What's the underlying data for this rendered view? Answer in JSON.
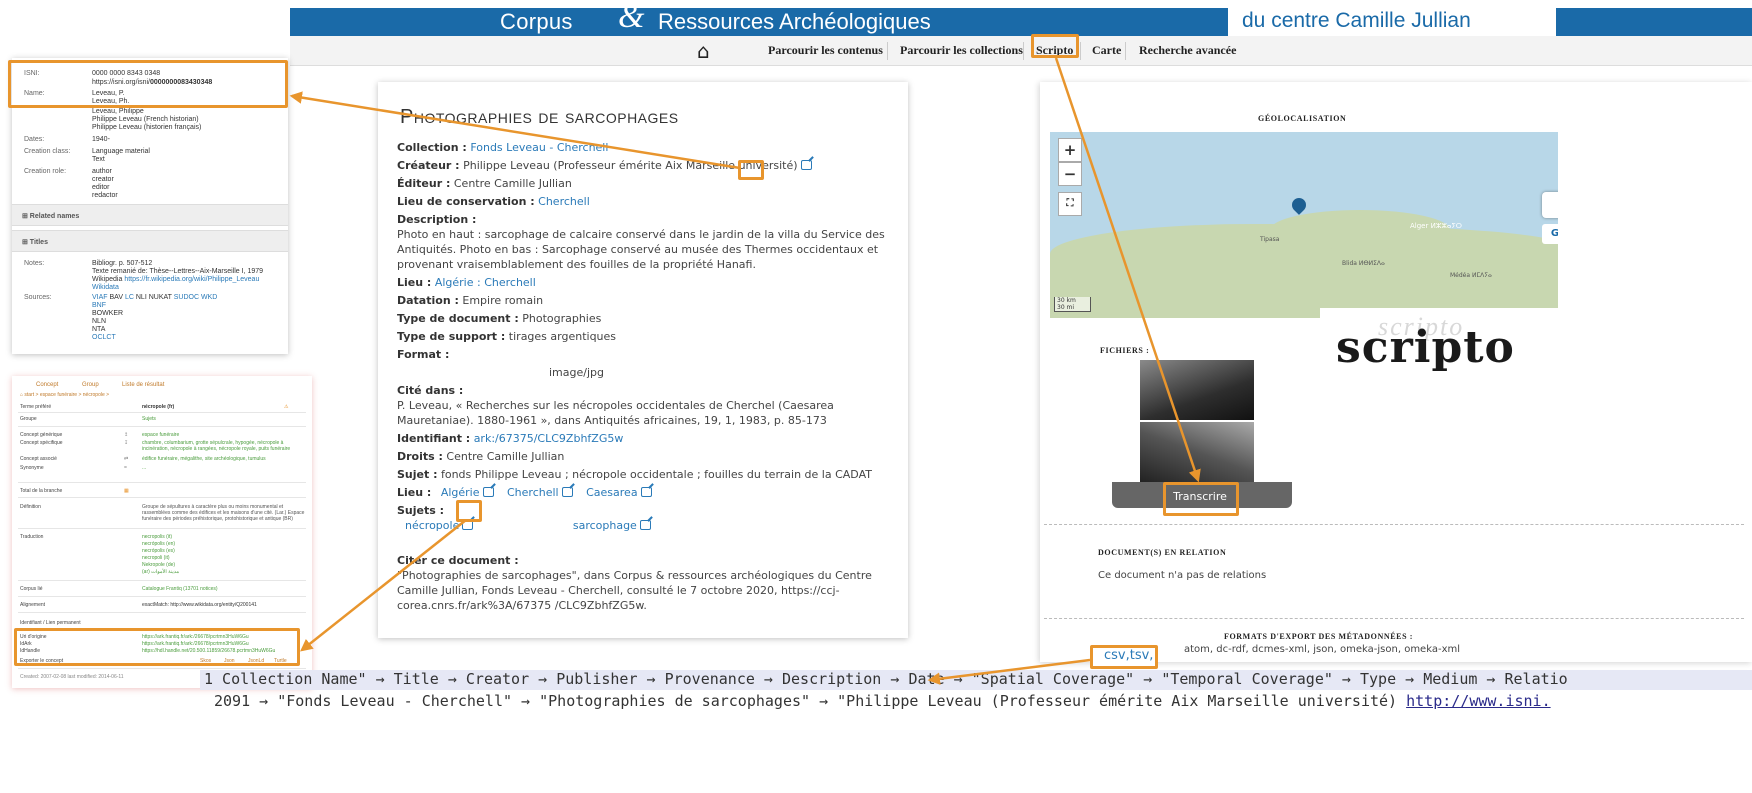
{
  "header": {
    "brand_left": "Corpus",
    "brand_amp": "&",
    "brand_right": "Ressources Archéologiques",
    "brand_center": "du centre Camille Jullian",
    "nav": [
      "Parcourir les contenus",
      "Parcourir les collections",
      "Scripto",
      "Carte",
      "Recherche avancée"
    ]
  },
  "record": {
    "title": "Photographies de sarcophages",
    "fields": {
      "collection_label": "Collection :",
      "collection_value": "Fonds Leveau - Cherchell",
      "createur_label": "Créateur :",
      "createur_value": "Philippe Leveau (Professeur émérite Aix Marseille université)",
      "editeur_label": "Éditeur :",
      "editeur_value": "Centre Camille Jullian",
      "lieu_cons_label": "Lieu de conservation :",
      "lieu_cons_value": "Cherchell",
      "description_label": "Description :",
      "description_value": "Photo en haut : sarcophage de calcaire conservé dans le jardin de la villa du Service des Antiquités. Photo en bas : Sarcophage conservé au musée des Thermes occidentaux et provenant vraisemblablement des fouilles de la propriété Hanafi.",
      "lieu_label": "Lieu :",
      "lieu_value": "Algérie : Cherchell",
      "datation_label": "Datation :",
      "datation_value": "Empire romain",
      "typedoc_label": "Type de document :",
      "typedoc_value": "Photographies",
      "typesupport_label": "Type de support :",
      "typesupport_value": "tirages argentiques",
      "format_label": "Format :",
      "format_value": "image/jpg",
      "cite_label": "Cité dans :",
      "cite_value": "P. Leveau, « Recherches sur les nécropoles occidentales de Cherchel (Caesarea Mauretaniae). 1880-1961 », dans Antiquités africaines, 19, 1, 1983, p. 85-173",
      "identifiant_label": "Identifiant :",
      "identifiant_value": "ark:/67375/CLC9ZbhfZG5w",
      "droits_label": "Droits :",
      "droits_value": "Centre Camille Jullian",
      "sujet_label": "Sujet :",
      "sujet_value": "fonds Philippe Leveau ; nécropole occidentale ; fouilles du terrain de la CADAT",
      "lieu2_label": "Lieu :",
      "lieu2_values": [
        "Algérie",
        "Cherchell",
        "Caesarea"
      ],
      "sujets_label": "Sujets :",
      "sujets_values": [
        "nécropole",
        "sarcophage"
      ],
      "citer_label": "Citer ce document :",
      "citer_value": "\"Photographies de sarcophages\", dans Corpus & ressources archéologiques du Centre Camille Jullian, Fonds Leveau - Cherchell, consulté le 7 octobre 2020, https://ccj-corea.cnrs.fr/ark%3A/67375 /CLC9ZbhfZG5w."
    }
  },
  "right_panel": {
    "geo_heading": "Géolocalisation",
    "map": {
      "zoom_in": "+",
      "zoom_out": "−",
      "places": [
        "Alger ⵍⵣⵣⴰⵢⵔ",
        "Blida ⵍⴱⵍⵉⴷⴰ",
        "Médéa ⵍⵎⴷⵢⴰ",
        "Tipasa"
      ],
      "scale": [
        "30 km",
        "30 mi"
      ],
      "google_label": "G"
    },
    "files_heading": "Fichiers :",
    "transcribe_label": "Transcrire",
    "related_heading": "Document(s) en relation",
    "related_text": "Ce document n'a pas de relations",
    "export_heading": "Formats d'export des métadonnées :",
    "export_formats": "atom, dc-rdf, dcmes-xml, json, omeka-json, omeka-xml",
    "csv_label": "csv,tsv,"
  },
  "scripto_logo": {
    "ghost": "scripto",
    "main": "scripto"
  },
  "isni_panel": {
    "isni_label": "ISNI:",
    "isni_value": "0000 0000 8343 0348",
    "isni_url_prefix": "https://isni.org/isni/",
    "isni_url_bold": "0000000083430348",
    "name_label": "Name:",
    "names": [
      "Leveau, P.",
      "Leveau, Ph.",
      "Leveau, Philippe",
      "Philippe Leveau (French historian)",
      "Philippe Leveau (historien français)"
    ],
    "dates_label": "Dates:",
    "dates_value": "1940-",
    "class_label": "Creation class:",
    "class_values": [
      "Language material",
      "Text"
    ],
    "role_label": "Creation role:",
    "role_values": [
      "author",
      "creator",
      "editor",
      "redactor"
    ],
    "related_band": "⊞ Related names",
    "titles_band": "⊞ Titles",
    "notes_label": "Notes:",
    "notes_values": [
      "Bibliogr. p. 507-512",
      "Texte remanié de: Thèse--Lettres--Aix-Marseille I, 1979"
    ],
    "notes_wiki_prefix": "Wikipedia",
    "notes_wiki_link": "https://fr.wikipedia.org/wiki/Philippe_Leveau",
    "notes_wikidata": "Wikidata",
    "sources_label": "Sources:",
    "sources_line1_links": [
      "VIAF",
      "LC",
      "SUDOC",
      "WKD"
    ],
    "sources_line1_plain": [
      "BAV",
      "NLI",
      "NUKAT"
    ],
    "sources_rest": [
      "BNF",
      "BOWKER",
      "NLN",
      "NTA",
      "OCLCT"
    ]
  },
  "thesaurus_panel": {
    "tabs": [
      "Concept",
      "Group",
      "Liste de résultat"
    ],
    "breadcrumb": "⌂ start > espace funéraire > nécropole >",
    "rows": [
      {
        "label": "Terme préféré",
        "value": "nécropole (fr)"
      },
      {
        "label": "Groupe",
        "value": "Sujets"
      },
      {
        "label": "Concept générique",
        "sym": "↥",
        "value": "espace funéraire"
      },
      {
        "label": "Concept spécifique",
        "sym": "↧",
        "value": "chambre, columbarium, grotte sépulcrale, hypogée, nécropole à incinération, nécropole à rangées, nécropole royale, puits funéraire"
      },
      {
        "label": "Concept associé",
        "sym": "⇄",
        "value": "édifice funéraire, mégalithe, site archéologique, tumulus"
      },
      {
        "label": "Synonyme",
        "sym": "=",
        "value": "..."
      },
      {
        "label": "Total de la branche",
        "value": ""
      },
      {
        "label": "Définition",
        "value": "Groupe de sépultures à caractère plus ou moins monumental et rassemblées comme des édifices et les maisons d'une cité. (Lar.) Espace funéraire des périodes préhistorique, protohistorique et antique (BR)"
      },
      {
        "label": "Traduction",
        "values": [
          "necropolis (it)",
          "necrópolis (en)",
          "necrópolis (es)",
          "necropoli (it)",
          "Nekropole (de)",
          "(ar) مدينة الأموات"
        ]
      },
      {
        "label": "Corpus lié",
        "value": "Catalogue Frantiq (13701 notices)"
      },
      {
        "label": "Alignement",
        "value": "exactMatch: http://www.wikidata.org/entity/Q200141"
      },
      {
        "label": "Identifiant / Lien permanent",
        "value": ""
      },
      {
        "label": "Uri d'origine",
        "value": "https://ark.frantiq.fr/ark:/26678/pcrtmn3HuW6Gu"
      },
      {
        "label": "IdArk",
        "value": "https://ark.frantiq.fr/ark:/26678/pcrtmn3HuW6Gu"
      },
      {
        "label": "IdHandle",
        "value": "https://hdl.handle.net/20.500.11859/26678.pcrtmn3HuW6Gu"
      }
    ],
    "export_label": "Exporter le concept",
    "export_formats": [
      "Skos",
      "Json",
      "JsonLd",
      "Turtle"
    ],
    "footer": "Created: 2007-02-08 last modified: 2014-06-11"
  },
  "bottom_strip": {
    "line1_prefix": "1 Collection Name\"",
    "line1_columns": [
      "Title",
      "Creator",
      "Publisher",
      "Provenance",
      "Description",
      "Date",
      "\"Spatial Coverage\"",
      "\"Temporal Coverage\"",
      "Type",
      "Medium",
      "Relatio"
    ],
    "line2_id": "2091",
    "line2_values": [
      "\"Fonds Leveau - Cherchell\"",
      "\"Photographies de sarcophages\"",
      "\"Philippe Leveau (Professeur émérite Aix Marseille université)"
    ],
    "line2_link": "http://www.isni."
  },
  "colors": {
    "accent_blue": "#1a6aa8",
    "link": "#2a7ab8",
    "annotation_orange": "#e8952d",
    "green_value": "#4a9c3c"
  }
}
